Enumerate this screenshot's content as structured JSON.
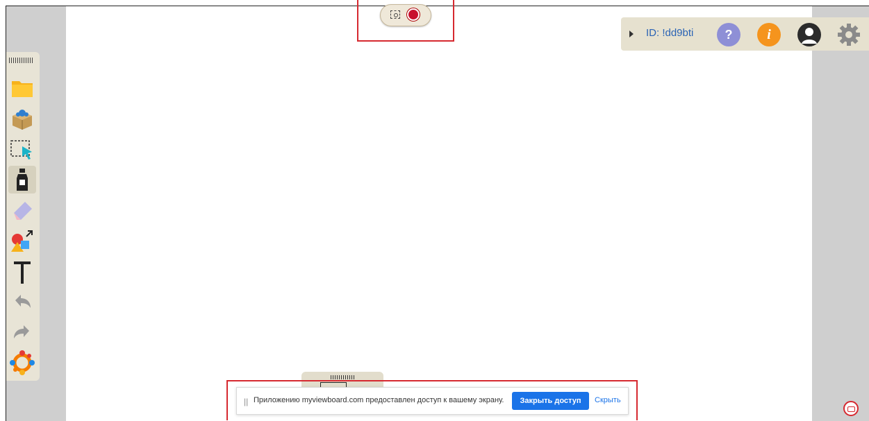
{
  "record_widget": {
    "screenshot_icon": "camera-capture-icon",
    "record_icon": "record-dot-icon"
  },
  "toolbar": {
    "tools": [
      {
        "id": "folder",
        "icon": "folder-icon"
      },
      {
        "id": "box",
        "icon": "box-icon"
      },
      {
        "id": "select",
        "icon": "selection-cursor-icon"
      },
      {
        "id": "pen",
        "icon": "marker-icon"
      },
      {
        "id": "eraser",
        "icon": "eraser-icon"
      },
      {
        "id": "shapes",
        "icon": "shapes-icon"
      },
      {
        "id": "text",
        "icon": "text-tool-icon",
        "glyph": "T"
      },
      {
        "id": "undo",
        "icon": "undo-icon"
      },
      {
        "id": "redo",
        "icon": "redo-icon"
      },
      {
        "id": "participants",
        "icon": "participants-icon"
      }
    ]
  },
  "topbar": {
    "room_id": "ID: !dd9bti",
    "help_label": "?",
    "info_label": "i",
    "colors": {
      "help": "#8e8fd6",
      "info": "#f5941d",
      "user": "#2b2b2b"
    }
  },
  "share_bar": {
    "drag_handle": "||",
    "message": "Приложению myviewboard.com предоставлен доступ к вашему экрану.",
    "stop_label": "Закрыть доступ",
    "hide_label": "Скрыть",
    "accent": "#1a73e8"
  }
}
